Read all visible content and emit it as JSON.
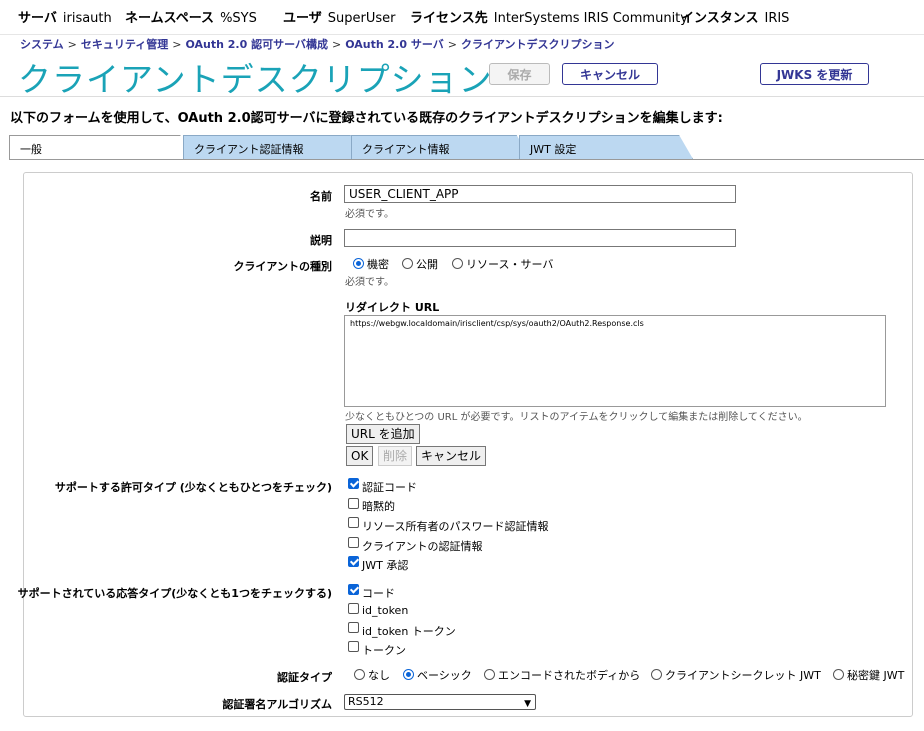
{
  "topbar": {
    "server_label": "サーバ",
    "server_value": "irisauth",
    "namespace_label": "ネームスペース",
    "namespace_value": "%SYS",
    "user_label": "ユーザ",
    "user_value": "SuperUser",
    "license_label": "ライセンス先",
    "license_value": "InterSystems IRIS Community",
    "instance_label": "インスタンス",
    "instance_value": "IRIS"
  },
  "breadcrumb": [
    "システム",
    "セキュリティ管理",
    "OAuth 2.0 認可サーバ構成",
    "OAuth 2.0 サーバ",
    "クライアントデスクリプション"
  ],
  "breadcrumb_sep": ">",
  "page_title": "クライアントデスクリプション",
  "toolbar": {
    "save_label": "保存",
    "cancel_label": "キャンセル",
    "jwks_label": "JWKS を更新"
  },
  "intro_text": "以下のフォームを使用して、OAuth 2.0認可サーバに登録されている既存のクライアントデスクリプションを編集します:",
  "tabs": [
    "一般",
    "クライアント認証情報",
    "クライアント情報",
    "JWT 設定"
  ],
  "form": {
    "name_label": "名前",
    "name_value": "USER_CLIENT_APP",
    "name_hint": "必須です。",
    "description_label": "説明",
    "description_value": "",
    "client_type_label": "クライアントの種別",
    "client_type_options": [
      "機密",
      "公開",
      "リソース・サーバ"
    ],
    "client_type_hint": "必須です。",
    "redirect_label": "リダイレクト URL",
    "redirect_value": "https://webgw.localdomain/irisclient/csp/sys/oauth2/OAuth2.Response.cls",
    "redirect_hint": "少なくともひとつの URL が必要です。リストのアイテムをクリックして編集または削除してください。",
    "add_url_label": "URL を追加",
    "ok_label": "OK",
    "delete_label": "削除",
    "cancel_label": "キャンセル",
    "grant_types_label": "サポートする許可タイプ (少なくともひとつをチェック)",
    "grant_types": [
      {
        "label": "認証コード",
        "checked": true
      },
      {
        "label": "暗黙的",
        "checked": false
      },
      {
        "label": "リソース所有者のパスワード認証情報",
        "checked": false
      },
      {
        "label": "クライアントの認証情報",
        "checked": false
      },
      {
        "label": "JWT 承認",
        "checked": true
      }
    ],
    "response_types_label": "サポートされている応答タイプ(少なくとも1つをチェックする)",
    "response_types": [
      {
        "label": "コード",
        "checked": true
      },
      {
        "label": "id_token",
        "checked": false
      },
      {
        "label": "id_token トークン",
        "checked": false
      },
      {
        "label": "トークン",
        "checked": false
      }
    ],
    "auth_type_label": "認証タイプ",
    "auth_type_options": [
      "なし",
      "ベーシック",
      "エンコードされたボディから",
      "クライアントシークレット JWT",
      "秘密鍵 JWT"
    ],
    "auth_type_selected": "ベーシック",
    "signing_alg_label": "認証署名アルゴリズム",
    "signing_alg_value": "RS512"
  },
  "colors": {
    "title": "#1aa3b7",
    "link": "#333695",
    "tab": "#bcd8f1",
    "check": "#0a64d8"
  }
}
